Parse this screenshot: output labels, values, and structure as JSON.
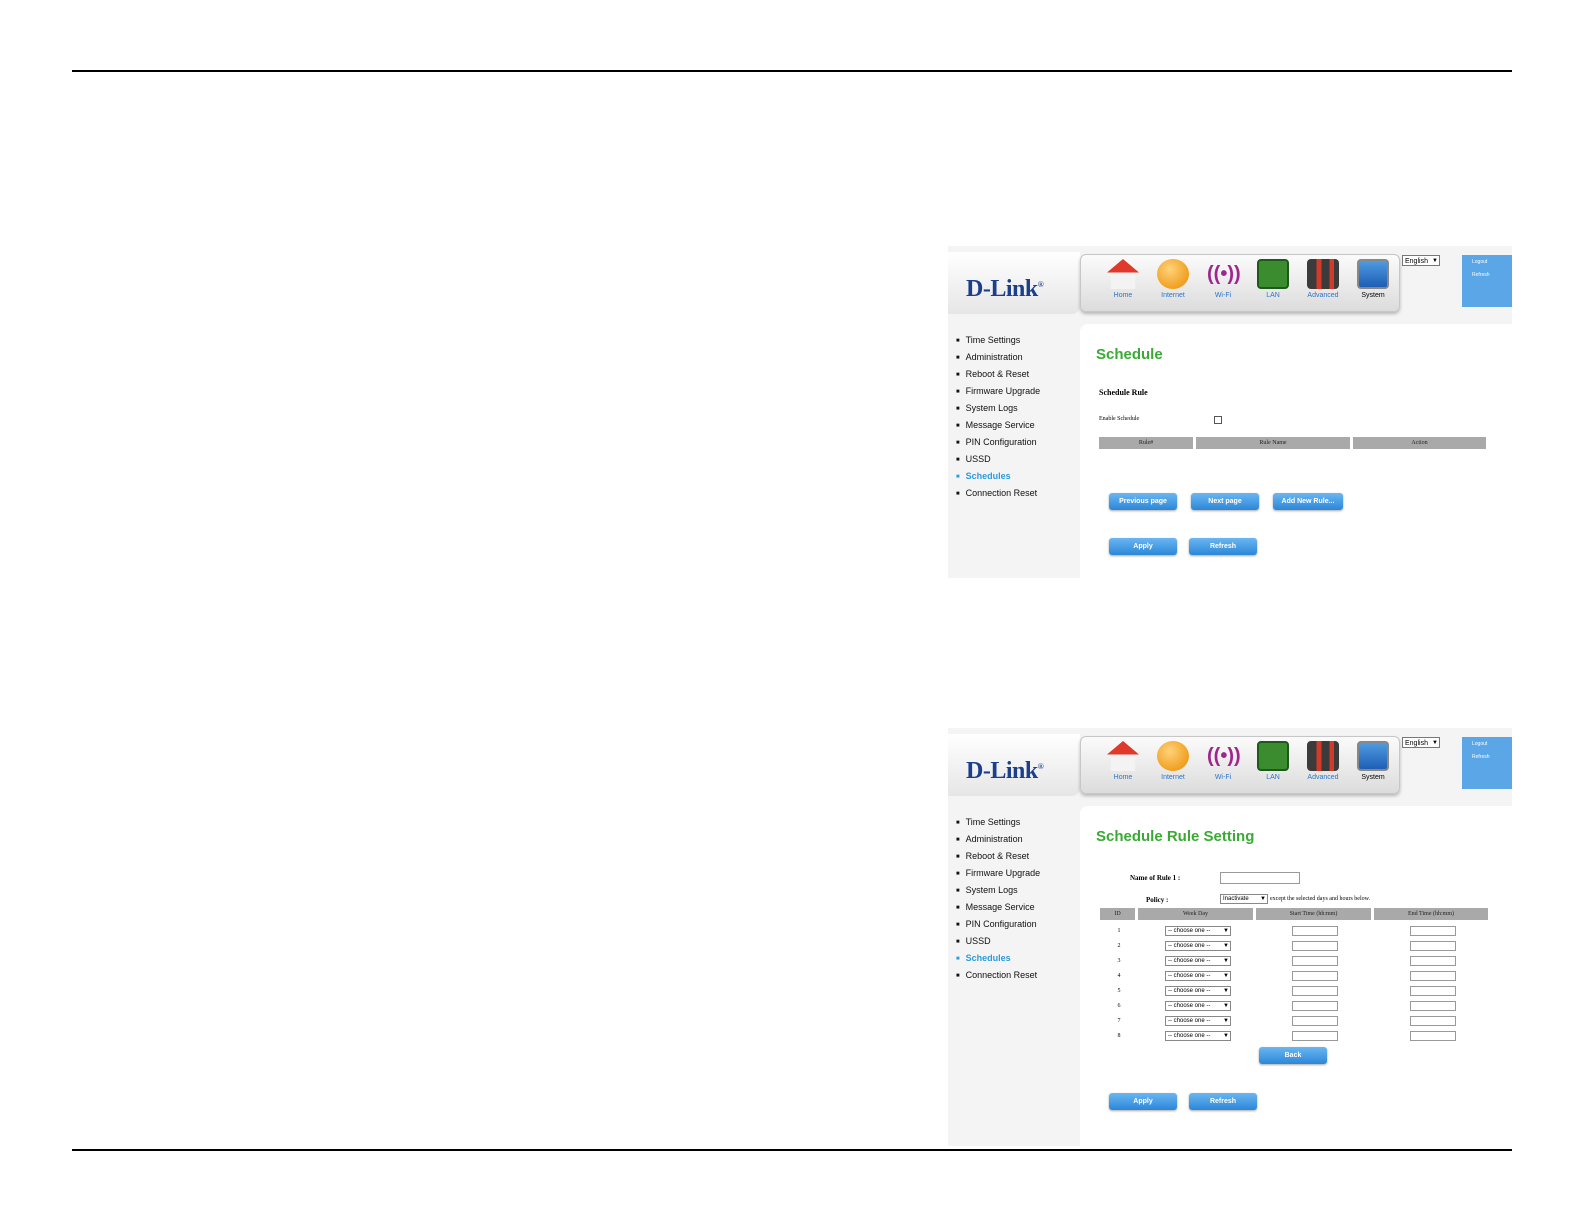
{
  "header_common": {
    "logo": "D-Link",
    "nav": [
      "Home",
      "Internet",
      "Wi-Fi",
      "LAN",
      "Advanced",
      "System"
    ],
    "language": "English",
    "side_links": [
      "Logout",
      "Refresh"
    ]
  },
  "menu": [
    "Time Settings",
    "Administration",
    "Reboot & Reset",
    "Firmware Upgrade",
    "System Logs",
    "Message Service",
    "PIN Configuration",
    "USSD",
    "Schedules",
    "Connection Reset"
  ],
  "screen1": {
    "title": "Schedule",
    "section": "Schedule Rule",
    "enable_label": "Enable Schedule",
    "columns": [
      "Rule#",
      "Rule Name",
      "Action"
    ],
    "buttons": {
      "prev": "Previous page",
      "next": "Next page",
      "add": "Add New Rule...",
      "apply": "Apply",
      "refresh": "Refresh"
    }
  },
  "screen2": {
    "title": "Schedule Rule Setting",
    "name_label": "Name of Rule 1 :",
    "policy_label": "Policy :",
    "policy_value": "Inactivate",
    "policy_suffix": "except the selected days and hours below.",
    "columns": [
      "ID",
      "Week Day",
      "Start Time (hh:mm)",
      "End Time (hh:mm)"
    ],
    "rows": [
      "1",
      "2",
      "3",
      "4",
      "5",
      "6",
      "7",
      "8"
    ],
    "day_placeholder": "-- choose one --",
    "buttons": {
      "back": "Back",
      "apply": "Apply",
      "refresh": "Refresh"
    }
  }
}
